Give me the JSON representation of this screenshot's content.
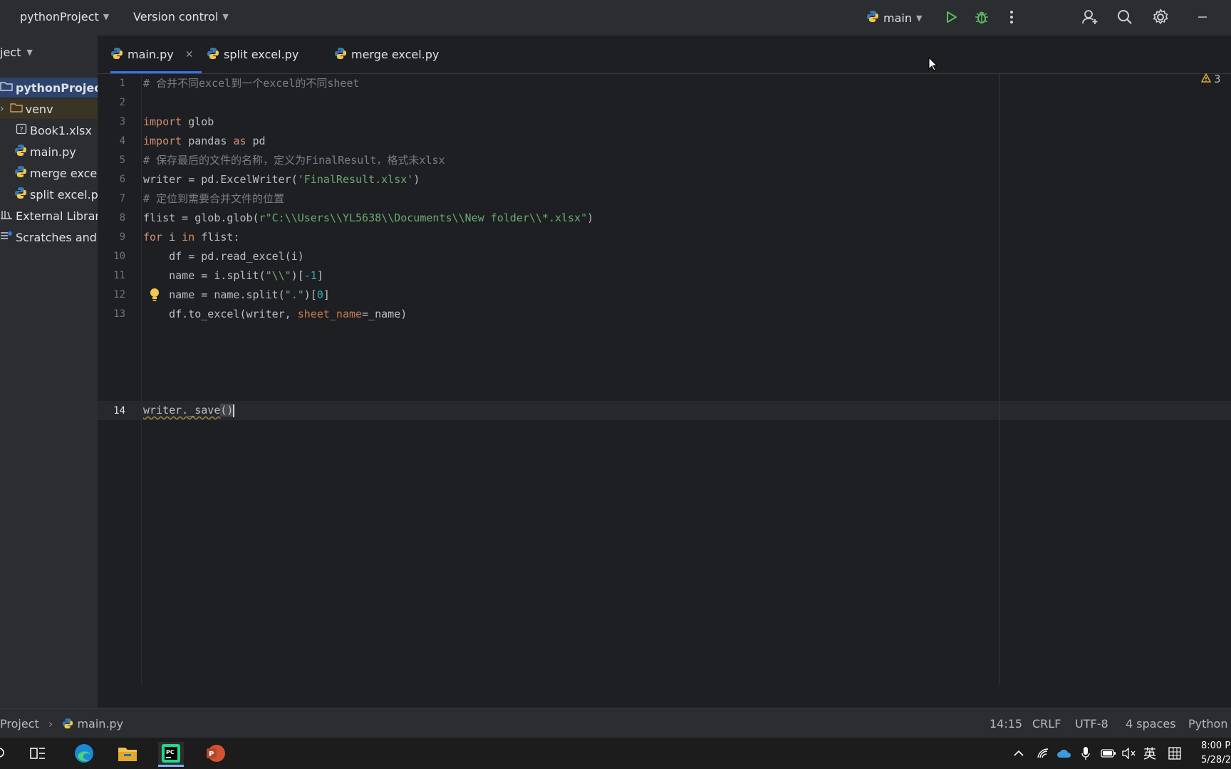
{
  "topbar": {
    "project": "pythonProject",
    "vcs": "Version control",
    "run_config": "main"
  },
  "project_panel": {
    "header": "ject",
    "items": [
      {
        "label": "pythonProjec",
        "icon": "folder-icon",
        "bold": true
      },
      {
        "label": "venv",
        "icon": "folder-icon"
      },
      {
        "label": "Book1.xlsx",
        "icon": "unknown-file-icon"
      },
      {
        "label": "main.py",
        "icon": "python-file-icon"
      },
      {
        "label": "merge excel",
        "icon": "python-file-icon"
      },
      {
        "label": "split excel.p",
        "icon": "python-file-icon"
      },
      {
        "label": "External Librari",
        "icon": "library-icon"
      },
      {
        "label": "Scratches and",
        "icon": "scratches-icon"
      }
    ]
  },
  "tabs": [
    {
      "label": "main.py",
      "active": true
    },
    {
      "label": "split excel.py",
      "active": false
    },
    {
      "label": "merge excel.py",
      "active": false
    }
  ],
  "editor": {
    "warning_count": "3",
    "lines": {
      "l1": "# 合并不同excel到一个excel的不同sheet",
      "l3a": "import",
      "l3b": " glob",
      "l4a": "import",
      "l4b": " pandas ",
      "l4c": "as",
      "l4d": " pd",
      "l5": "# 保存最后的文件的名称，定义为FinalResult，格式未xlsx",
      "l6a": "writer = pd.ExcelWriter(",
      "l6b": "'FinalResult.xlsx'",
      "l6c": ")",
      "l7": "# 定位到需要合并文件的位置",
      "l8a": "flist = glob.glob(",
      "l8b": "r\"C:\\\\Users\\\\YL5638\\\\Documents\\\\New folder\\\\*.xlsx\"",
      "l8c": ")",
      "l9a": "for",
      "l9b": " i ",
      "l9c": "in",
      "l9d": " flist:",
      "l10": "    df = pd.read_excel(i)",
      "l11a": "    name = i.split(",
      "l11b": "\"\\\\\"",
      "l11c": ")[",
      "l11d": "-1",
      "l11e": "]",
      "l12a": "    name = name.split(",
      "l12b": "\".\"",
      "l12c": ")[",
      "l12d": "0",
      "l12e": "]",
      "l13a": "    df.to_excel(writer, ",
      "l13b": "sheet_name",
      "l13c": "=_name)",
      "l14a": "writer._save",
      "l14b": "(",
      "l14c": ")"
    },
    "line_numbers": [
      "1",
      "2",
      "3",
      "4",
      "5",
      "6",
      "7",
      "8",
      "9",
      "10",
      "11",
      "12",
      "13",
      "14"
    ]
  },
  "statusbar": {
    "breadcrumb_root": "Project",
    "breadcrumb_file": "main.py",
    "position": "14:15",
    "line_sep": "CRLF",
    "encoding": "UTF-8",
    "indent": "4 spaces",
    "language": "Python"
  },
  "taskbar": {
    "ime": "英",
    "time": "8:00 P",
    "date": "5/28/2"
  },
  "colors": {
    "accent": "#3574f0",
    "keyword": "#cf8e6d",
    "string": "#6aab73",
    "comment": "#7a7e85"
  }
}
